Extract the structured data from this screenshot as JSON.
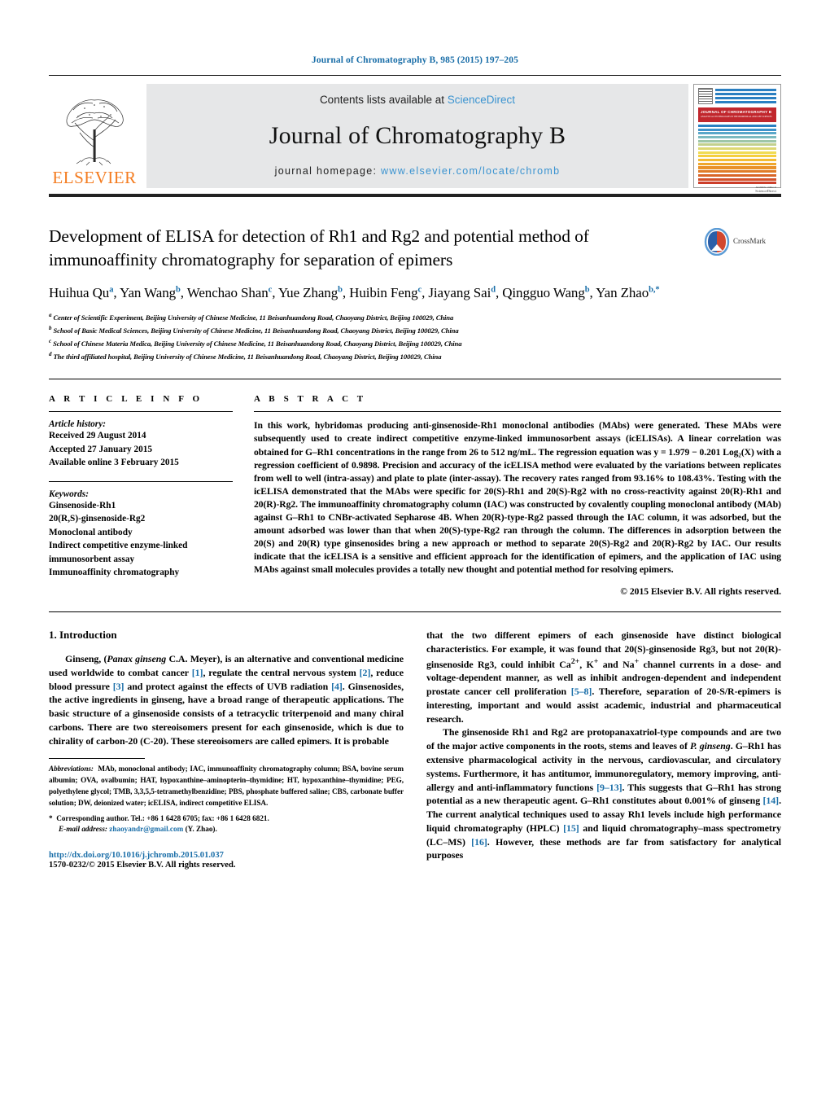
{
  "running_head": "Journal of Chromatography B, 985 (2015) 197–205",
  "masthead": {
    "contents_prefix": "Contents lists available at ",
    "sciencedirect": "ScienceDirect",
    "journal_name": "Journal of Chromatography B",
    "homepage_prefix": "journal homepage: ",
    "homepage_url": "www.elsevier.com/locate/chromb",
    "publisher": "ELSEVIER",
    "cover_title": "JOURNAL OF CHROMATOGRAPHY B",
    "cover_subtitle": "ANALYTICAL TECHNOLOGIES IN THE BIOMEDICAL AND LIFE SCIENCES",
    "cover_footer_small": "Available online at",
    "cover_footer": "ScienceDirect",
    "accent_blue": "#1a6ea8",
    "link_blue": "#3a93d0",
    "elsevier_orange": "#f47c20",
    "cover_red": "#c1272d"
  },
  "title": "Development of ELISA for detection of Rh1 and Rg2 and potential method of immunoaffinity chromatography for separation of epimers",
  "crossmark_label": "CrossMark",
  "authors_html": "Huihua Qu<sup>a</sup>, Yan Wang<sup>b</sup>, Wenchao Shan<sup>c</sup>, Yue Zhang<sup>b</sup>, Huibin Feng<sup>c</sup>, Jiayang Sai<sup>d</sup>, Qingguo Wang<sup>b</sup>, Yan Zhao<sup>b,</sup><sup>*</sup>",
  "affiliations": [
    {
      "marker": "a",
      "text": "Center of Scientific Experiment, Beijing University of Chinese Medicine, 11 Beisanhuandong Road, Chaoyang District, Beijing 100029, China"
    },
    {
      "marker": "b",
      "text": "School of Basic Medical Sciences, Beijing University of Chinese Medicine, 11 Beisanhuandong Road, Chaoyang District, Beijing 100029, China"
    },
    {
      "marker": "c",
      "text": "School of Chinese Materia Medica, Beijing University of Chinese Medicine, 11 Beisanhuandong Road, Chaoyang District, Beijing 100029, China"
    },
    {
      "marker": "d",
      "text": "The third affiliated hospital, Beijing University of Chinese Medicine, 11 Beisanhuandong Road, Chaoyang District, Beijing 100029, China"
    }
  ],
  "article_info": {
    "heading": "A R T I C L E    I N F O",
    "history_label": "Article history:",
    "history": [
      "Received 29 August 2014",
      "Accepted 27 January 2015",
      "Available online 3 February 2015"
    ],
    "keywords_label": "Keywords:",
    "keywords": [
      "Ginsenoside-Rh1",
      "20(R,S)-ginsenoside-Rg2",
      "Monoclonal antibody",
      "Indirect competitive enzyme-linked",
      "immunosorbent assay",
      "Immunoaffinity chromatography"
    ]
  },
  "abstract": {
    "heading": "A B S T R A C T",
    "text": "In this work, hybridomas producing anti-ginsenoside-Rh1 monoclonal antibodies (MAbs) were generated. These MAbs were subsequently used to create indirect competitive enzyme-linked immunosorbent assays (icELISAs). A linear correlation was obtained for G–Rh1 concentrations in the range from 26 to 512 ng/mL. The regression equation was y = 1.979 − 0.201 Log₂(X) with a regression coefficient of 0.9898. Precision and accuracy of the icELISA method were evaluated by the variations between replicates from well to well (intra-assay) and plate to plate (inter-assay). The recovery rates ranged from 93.16% to 108.43%. Testing with the icELISA demonstrated that the MAbs were specific for 20(S)-Rh1 and 20(S)-Rg2 with no cross-reactivity against 20(R)-Rh1 and 20(R)-Rg2. The immunoaffinity chromatography column (IAC) was constructed by covalently coupling monoclonal antibody (MAb) against G–Rh1 to CNBr-activated Sepharose 4B. When 20(R)-type-Rg2 passed through the IAC column, it was adsorbed, but the amount adsorbed was lower than that when 20(S)-type-Rg2 ran through the column. The differences in adsorption between the 20(S) and 20(R) type ginsenosides bring a new approach or method to separate 20(S)-Rg2 and 20(R)-Rg2 by IAC. Our results indicate that the icELISA is a sensitive and efficient approach for the identification of epimers, and the application of IAC using MAbs against small molecules provides a totally new thought and potential method for resolving epimers.",
    "copyright": "© 2015 Elsevier B.V. All rights reserved."
  },
  "introduction": {
    "heading": "1. Introduction",
    "left_p1_html": "Ginseng, (<i>Panax ginseng</i> C.A. Meyer), is an alternative and conventional medicine used worldwide to combat cancer <span class=\"ref\">[1]</span>, regulate the central nervous system <span class=\"ref\">[2]</span>, reduce blood pressure <span class=\"ref\">[3]</span> and protect against the effects of UVB radiation <span class=\"ref\">[4]</span>. Ginsenosides, the active ingredients in ginseng, have a broad range of therapeutic applications. The basic structure of a ginsenoside consists of a tetracyclic triterpenoid and many chiral carbons. There are two stereoisomers present for each ginsenoside, which is due to chirality of carbon-20 (C-20). These stereoisomers are called epimers. It is probable",
    "right_p1_html": "that the two different epimers of each ginsenoside have distinct biological characteristics. For example, it was found that 20(S)-ginsenoside Rg3, but not 20(R)-ginsenoside Rg3, could inhibit Ca<sup>2+</sup>, K<sup>+</sup> and Na<sup>+</sup> channel currents in a dose- and voltage-dependent manner, as well as inhibit androgen-dependent and independent prostate cancer cell proliferation <span class=\"ref\">[5–8]</span>. Therefore, separation of 20-S/R-epimers is interesting, important and would assist academic, industrial and pharmaceutical research.",
    "right_p2_html": "The ginsenoside Rh1 and Rg2 are protopanaxatriol-type compounds and are two of the major active components in the roots, stems and leaves of <i>P. ginseng</i>. G–Rh1 has extensive pharmacological activity in the nervous, cardiovascular, and circulatory systems. Furthermore, it has antitumor, immunoregulatory, memory improving, anti-allergy and anti-inflammatory functions <span class=\"ref\">[9–13]</span>. This suggests that G–Rh1 has strong potential as a new therapeutic agent. G–Rh1 constitutes about 0.001% of ginseng <span class=\"ref\">[14]</span>. The current analytical techniques used to assay Rh1 levels include high performance liquid chromatography (HPLC) <span class=\"ref\">[15]</span> and liquid chromatography–mass spectrometry (LC–MS) <span class=\"ref\">[16]</span>. However, these methods are far from satisfactory for analytical purposes"
  },
  "footnotes": {
    "abbreviations_html": "<i>Abbreviations:</i>&nbsp; MAb, monoclonal antibody; IAC, immunoaffinity chromatography column; BSA, bovine serum albumin; OVA, ovalbumin; HAT, hypoxanthine–aminopterin–thymidine; HT, hypoxanthine–thymidine; PEG, polyethylene glycol; TMB, 3,3,5,5-tetramethylbenzidine; PBS, phosphate buffered saline; CBS, carbonate buffer solution; DW, deionized water; icELISA, indirect competitive ELISA.",
    "corresponding": "Corresponding author. Tel.: +86 1 6428 6705; fax: +86 1 6428 6821.",
    "email_label": "E-mail address:",
    "email": "zhaoyandr@gmail.com",
    "email_suffix": "(Y. Zhao).",
    "doi": "http://dx.doi.org/10.1016/j.jchromb.2015.01.037",
    "issn": "1570-0232/© 2015 Elsevier B.V. All rights reserved."
  }
}
